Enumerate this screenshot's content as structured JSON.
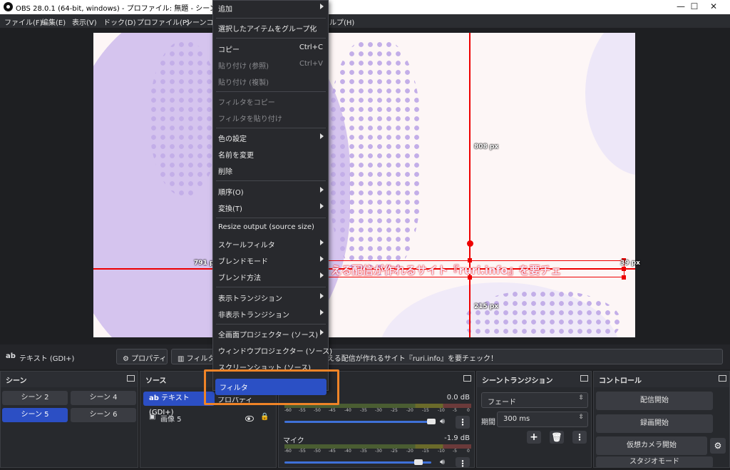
{
  "window": {
    "title": "OBS 28.0.1 (64-bit, windows) - プロファイル: 無題 - シーン: 無題",
    "min": "—",
    "max": "☐",
    "close": "✕"
  },
  "menubar": [
    "ファイル(F)",
    "編集(E)",
    "表示(V)",
    "ドック(D)",
    "プロファイル(P)",
    "シーンコレ",
    "ルプ(H)"
  ],
  "preview": {
    "width_label": "808 px",
    "left_label": "791 px",
    "right_label": "39 px",
    "bottom_label": "215 px",
    "caption": "える配信が作れるサイト『ruri.info』を要チェ"
  },
  "source_toolbar": {
    "source_icon": "ab",
    "source_name": "テキスト (GDI+)",
    "properties": "プロパティ",
    "filters": "フィルタ",
    "text_value": "映える配信が作れるサイト『ruri.info』を要チェック！"
  },
  "scenes": {
    "title": "シーン",
    "items": [
      "シーン 2",
      "シーン 4",
      "シーン 5",
      "シーン 6"
    ],
    "selected": "シーン 5"
  },
  "sources": {
    "title": "ソース",
    "items": [
      {
        "icon": "ab",
        "name": "テキスト (GDI+)"
      },
      {
        "icon": "▣",
        "name": "画像 5"
      }
    ]
  },
  "mixer": {
    "tracks": [
      {
        "name": "",
        "db": "0.0 dB",
        "level": 0.97
      },
      {
        "name": "マイク",
        "db": "-1.9 dB",
        "level": 0.95
      }
    ],
    "ticks": [
      "-60",
      "-55",
      "-50",
      "-45",
      "-40",
      "-35",
      "-30",
      "-25",
      "-20",
      "-15",
      "-10",
      "-5",
      "0"
    ]
  },
  "transitions": {
    "title": "シーントランジション",
    "type": "フェード",
    "duration_label": "期間",
    "duration": "300 ms"
  },
  "controls": {
    "title": "コントロール",
    "start_stream": "配信開始",
    "start_record": "録画開始",
    "virtual_cam": "仮想カメラ開始",
    "studio_mode": "スタジオモード"
  },
  "context_menu": {
    "items": [
      {
        "label": "追加",
        "arrow": true
      },
      {
        "label": "選択したアイテムをグループ化"
      },
      {
        "label": "コピー",
        "shortcut": "Ctrl+C"
      },
      {
        "label": "貼り付け (参照)",
        "shortcut": "Ctrl+V",
        "disabled": true
      },
      {
        "label": "貼り付け (複製)",
        "disabled": true
      },
      {
        "label": "フィルタをコピー",
        "disabled": true
      },
      {
        "label": "フィルタを貼り付け",
        "disabled": true
      },
      {
        "label": "色の設定",
        "arrow": true
      },
      {
        "label": "名前を変更"
      },
      {
        "label": "削除"
      },
      {
        "label": "順序(O)",
        "arrow": true
      },
      {
        "label": "変換(T)",
        "arrow": true
      },
      {
        "label": "Resize output (source size)"
      },
      {
        "label": "スケールフィルタ",
        "arrow": true
      },
      {
        "label": "ブレンドモード",
        "arrow": true
      },
      {
        "label": "ブレンド方法",
        "arrow": true
      },
      {
        "label": "表示トランジション",
        "arrow": true
      },
      {
        "label": "非表示トランジション",
        "arrow": true
      },
      {
        "label": "全画面プロジェクター (ソース)",
        "arrow": true
      },
      {
        "label": "ウィンドウプロジェクター (ソース)"
      },
      {
        "label": "スクリーンショット (ソース)"
      },
      {
        "label": "フィルタ",
        "highlighted": true
      },
      {
        "label": "プロパティ"
      }
    ]
  },
  "colors": {
    "accent": "#2b50c5",
    "guide": "#e00000",
    "callout": "#f08427"
  }
}
